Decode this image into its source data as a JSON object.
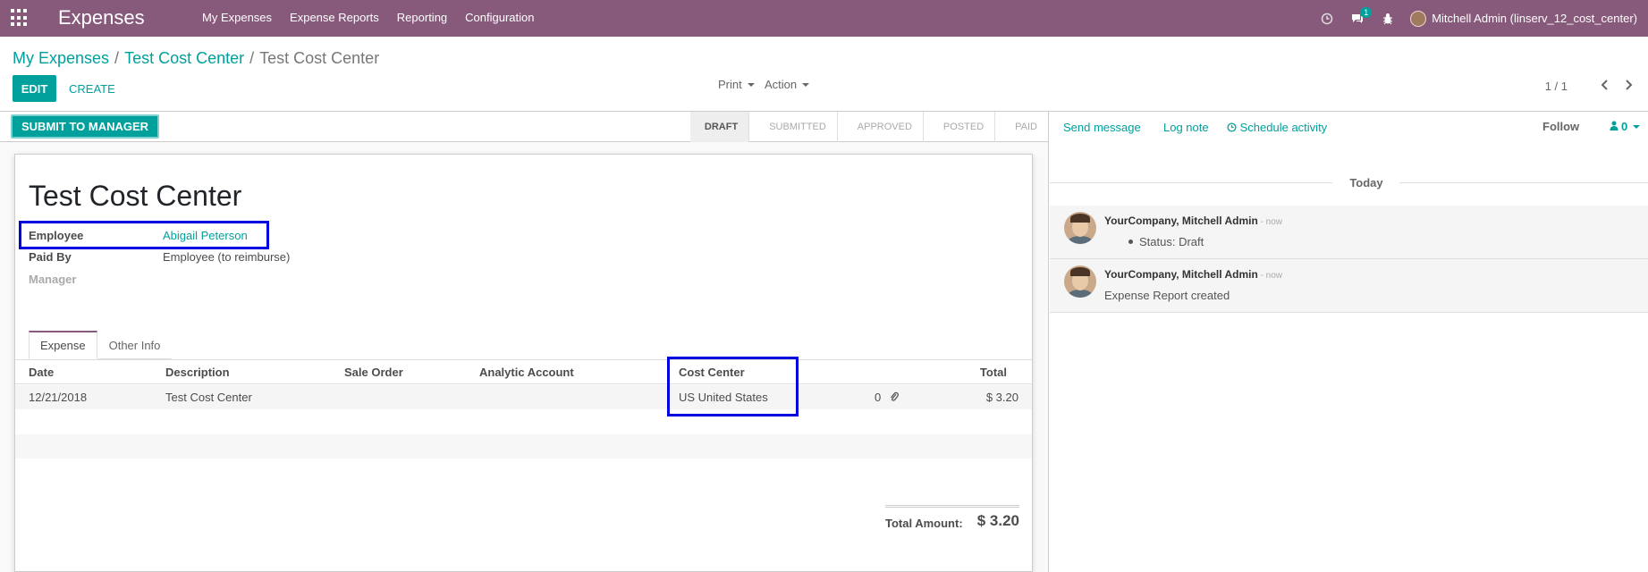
{
  "navbar": {
    "app_name": "Expenses",
    "menu": [
      "My Expenses",
      "Expense Reports",
      "Reporting",
      "Configuration"
    ],
    "messages_badge": "1",
    "user": "Mitchell Admin (linserv_12_cost_center)"
  },
  "breadcrumb": {
    "items": [
      "My Expenses",
      "Test Cost Center"
    ],
    "active": "Test Cost Center"
  },
  "toolbar": {
    "edit_label": "EDIT",
    "create_label": "CREATE",
    "print_label": "Print",
    "action_label": "Action",
    "pager": "1 / 1"
  },
  "statusbar": {
    "submit_label": "SUBMIT TO MANAGER",
    "stages": [
      "DRAFT",
      "SUBMITTED",
      "APPROVED",
      "POSTED",
      "PAID"
    ],
    "active_stage": "DRAFT"
  },
  "form": {
    "title": "Test Cost Center",
    "fields": {
      "employee_label": "Employee",
      "employee_value": "Abigail Peterson",
      "paid_by_label": "Paid By",
      "paid_by_value": "Employee (to reimburse)",
      "manager_label": "Manager"
    },
    "tabs": [
      "Expense",
      "Other Info"
    ],
    "table": {
      "headers": [
        "Date",
        "Description",
        "Sale Order",
        "Analytic Account",
        "Cost Center",
        "Total"
      ],
      "rows": [
        {
          "date": "12/21/2018",
          "description": "Test Cost Center",
          "sale_order": "",
          "analytic_account": "",
          "cost_center": "US United States",
          "attachments": "0",
          "total": "$ 3.20"
        }
      ]
    },
    "total_label": "Total Amount:",
    "total_value": "$ 3.20"
  },
  "chatter": {
    "send_message": "Send message",
    "log_note": "Log note",
    "schedule_activity": "Schedule activity",
    "follow": "Follow",
    "followers_count": "0",
    "date_separator": "Today",
    "messages": [
      {
        "author": "YourCompany, Mitchell Admin",
        "date": " - now",
        "body": "Status: Draft"
      },
      {
        "author": "YourCompany, Mitchell Admin",
        "date": " - now",
        "body": "Expense Report created"
      }
    ]
  },
  "colors": {
    "navbar": "#875a7b",
    "accent": "#00a09d",
    "highlight_box": "#0000e0"
  }
}
